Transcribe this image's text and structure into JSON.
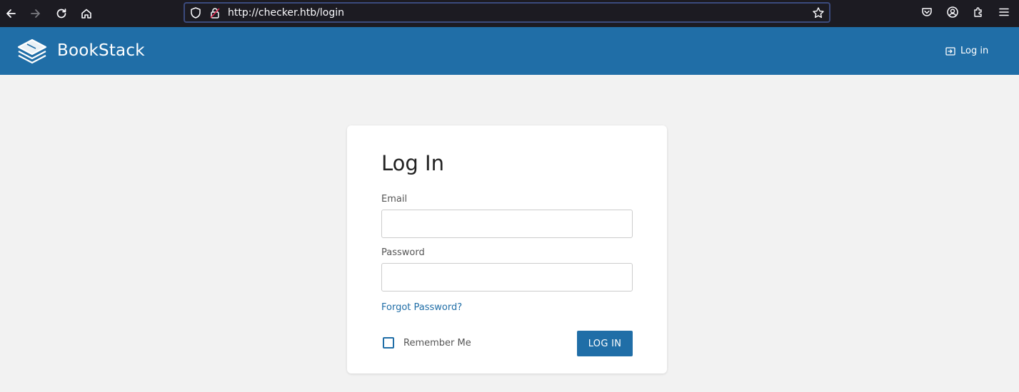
{
  "browser": {
    "url": "http://checker.htb/login",
    "icons": [
      "back-icon",
      "forward-icon",
      "reload-icon",
      "home-icon",
      "shield-icon",
      "lock-icon",
      "bookmark-star-icon",
      "pocket-icon",
      "account-icon",
      "extensions-icon",
      "menu-icon"
    ]
  },
  "header": {
    "brand": "BookStack",
    "login_link": "Log in"
  },
  "login_form": {
    "title": "Log In",
    "email_label": "Email",
    "email_value": "",
    "password_label": "Password",
    "password_value": "",
    "forgot_password": "Forgot Password?",
    "remember_me": "Remember Me",
    "remember_checked": false,
    "submit_label": "LOG IN"
  },
  "colors": {
    "brand": "#206ea7",
    "browser_bg": "#1c1b22",
    "page_bg": "#f2f2f2"
  }
}
